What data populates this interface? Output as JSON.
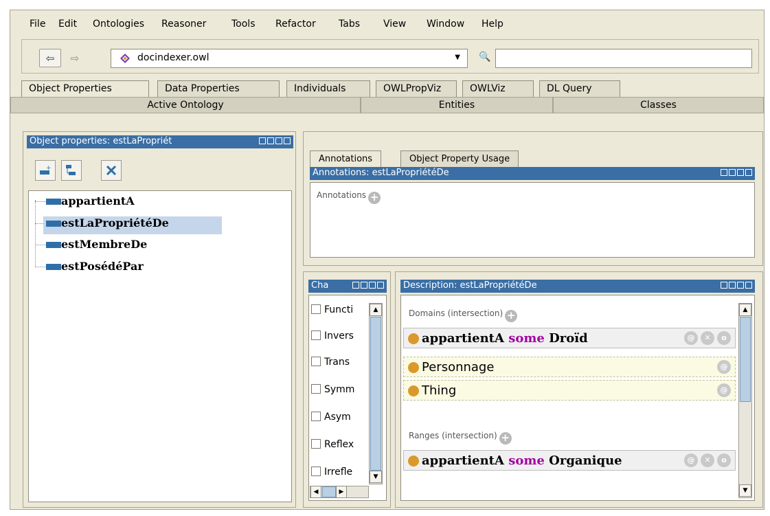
{
  "menu": [
    "File",
    "Edit",
    "Ontologies",
    "Reasoner",
    "Tools",
    "Refactor",
    "Tabs",
    "View",
    "Window",
    "Help"
  ],
  "toolbar": {
    "back_glyph": "⇦",
    "forward_glyph": "⇨",
    "ontology": "docindexer.owl",
    "search_value": ""
  },
  "tabs": [
    "Object Properties",
    "Data Properties",
    "Individuals",
    "OWLPropViz",
    "OWLViz",
    "DL Query"
  ],
  "subtabs": [
    "Active Ontology",
    "Entities",
    "Classes"
  ],
  "left_panel": {
    "title": "Object properties: estLaPropriét",
    "items": [
      "appartientA",
      "estLaPropriétéDe",
      "estMembreDe",
      "estPosédéPar"
    ]
  },
  "annotations": {
    "tabs": [
      "Annotations",
      "Object Property Usage"
    ],
    "title": "Annotations: estLaPropriétéDe",
    "label": "Annotations"
  },
  "characteristics": {
    "title": "Cha",
    "items": [
      "Functi",
      "Invers",
      "Trans",
      "Symm",
      "Asym",
      "Reflex",
      "Irrefle"
    ]
  },
  "description": {
    "title": "Description: estLaPropriétéDe",
    "domains_label": "Domains (intersection)",
    "domains": [
      {
        "prop": "appartientA",
        "kw": "some",
        "cls": "Droïd"
      },
      {
        "text": "Personnage"
      },
      {
        "text": "Thing"
      }
    ],
    "ranges_label": "Ranges (intersection)",
    "ranges": [
      {
        "prop": "appartientA",
        "kw": "some",
        "cls": "Organique"
      }
    ]
  },
  "colors": {
    "titlebar": "#3a6ea5",
    "selection": "#c5d6ea",
    "keyword": "#a300a3",
    "class_dot": "#d99a2b"
  }
}
